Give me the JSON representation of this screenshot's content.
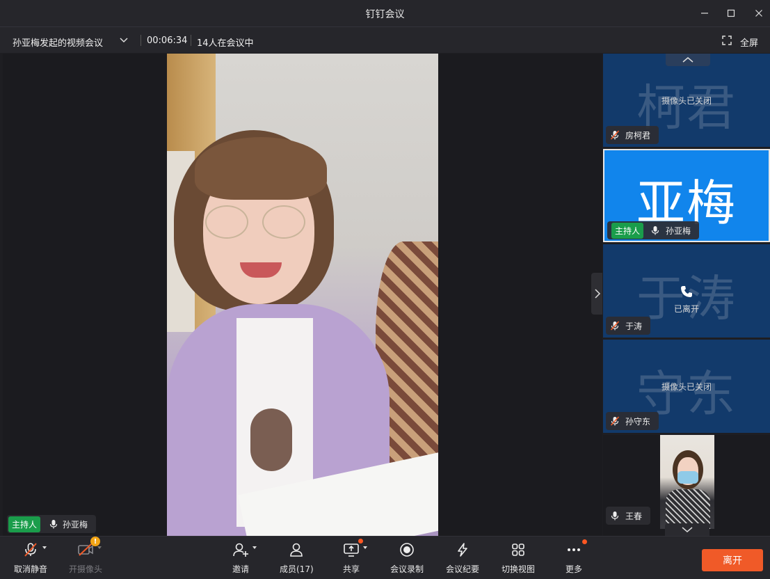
{
  "window": {
    "title": "钉钉会议"
  },
  "info": {
    "meeting_name": "孙亚梅发起的视频会议",
    "duration": "00:06:34",
    "participant_count": "14人在会议中",
    "fullscreen_label": "全屏"
  },
  "stage": {
    "host_badge": "主持人",
    "speaker_name": "孙亚梅"
  },
  "participants": [
    {
      "big_name": "柯君",
      "status": "摄像头已关闭",
      "name": "房柯君",
      "mic": "muted",
      "host": false
    },
    {
      "big_name": "亚梅",
      "status": "",
      "name": "孙亚梅",
      "mic": "on",
      "host": true,
      "host_badge": "主持人",
      "active": true
    },
    {
      "big_name": "于涛",
      "status": "已离开",
      "name": "于涛",
      "mic": "muted",
      "host": false
    },
    {
      "big_name": "守东",
      "status": "摄像头已关闭",
      "name": "孙守东",
      "mic": "muted",
      "host": false
    },
    {
      "big_name": "",
      "status": "",
      "name": "王春",
      "mic": "on",
      "host": false,
      "video": true
    }
  ],
  "toolbar": {
    "unmute": "取消静音",
    "camera": "开摄像头",
    "invite": "邀请",
    "members": "成员(17)",
    "share": "共享",
    "record": "会议录制",
    "minutes": "会议纪要",
    "view": "切换视图",
    "more": "更多",
    "leave": "离开",
    "camera_warning": "!"
  },
  "colors": {
    "accent_blue": "#1185ec",
    "tile_blue": "#123a6b",
    "host_green": "#1a9d4b",
    "leave_orange": "#f05a28",
    "notify_dot": "#ff5722"
  }
}
